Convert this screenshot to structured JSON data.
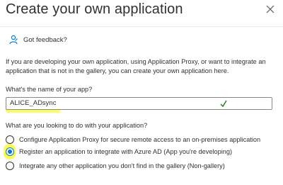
{
  "header": {
    "title": "Create your own application",
    "close_icon": "close-icon"
  },
  "feedback": {
    "label": "Got feedback?",
    "icon": "feedback-person-icon"
  },
  "description": "If you are developing your own application, using Application Proxy, or want to integrate an application that is not in the gallery, you can create your own application here.",
  "app_name": {
    "question": "What's the name of your app?",
    "value": "ALICE_ADsync",
    "valid_icon": "checkmark-icon",
    "highlight_color": "#fdfd52"
  },
  "purpose": {
    "question": "What are you looking to do with your application?",
    "options": [
      {
        "label": "Configure Application Proxy for secure remote access to an on-premises application",
        "selected": false
      },
      {
        "label": "Register an application to integrate with Azure AD (App you're developing)",
        "selected": true
      },
      {
        "label": "Integrate any other application you don't find in the gallery (Non-gallery)",
        "selected": false
      }
    ]
  },
  "colors": {
    "accent": "#0078d4",
    "text": "#323130",
    "border": "#8a8886",
    "valid": "#107c10"
  }
}
